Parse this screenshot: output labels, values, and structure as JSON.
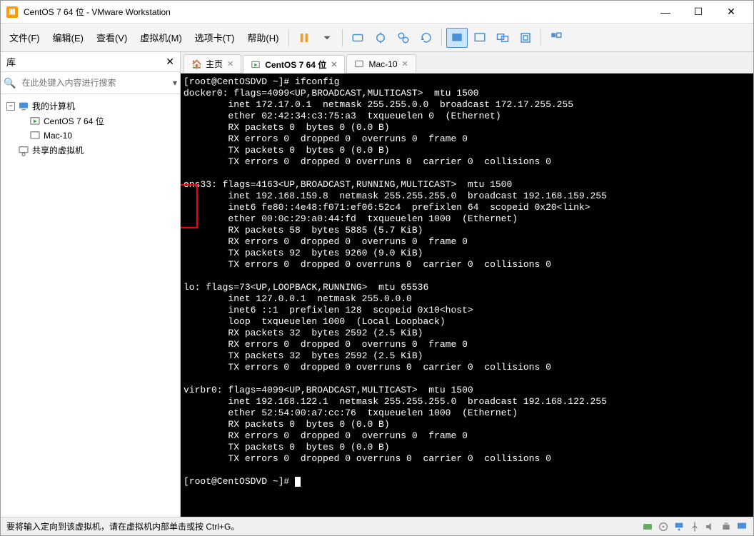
{
  "window": {
    "title": "CentOS 7 64 位 - VMware Workstation"
  },
  "menus": [
    "文件(F)",
    "编辑(E)",
    "查看(V)",
    "虚拟机(M)",
    "选项卡(T)",
    "帮助(H)"
  ],
  "sidebar": {
    "title": "库",
    "search_placeholder": "在此处键入内容进行搜索",
    "nodes": {
      "root": "我的计算机",
      "vm1": "CentOS 7 64 位",
      "vm2": "Mac-10",
      "shared": "共享的虚拟机"
    }
  },
  "tabs": {
    "home": "主页",
    "centos": "CentOS 7 64 位",
    "mac": "Mac-10"
  },
  "terminal_text": "[root@CentOSDVD ~]# ifconfig\ndocker0: flags=4099<UP,BROADCAST,MULTICAST>  mtu 1500\n        inet 172.17.0.1  netmask 255.255.0.0  broadcast 172.17.255.255\n        ether 02:42:34:c3:75:a3  txqueuelen 0  (Ethernet)\n        RX packets 0  bytes 0 (0.0 B)\n        RX errors 0  dropped 0  overruns 0  frame 0\n        TX packets 0  bytes 0 (0.0 B)\n        TX errors 0  dropped 0 overruns 0  carrier 0  collisions 0\n\nens33: flags=4163<UP,BROADCAST,RUNNING,MULTICAST>  mtu 1500\n        inet 192.168.159.8  netmask 255.255.255.0  broadcast 192.168.159.255\n        inet6 fe80::4e48:f071:ef06:52c4  prefixlen 64  scopeid 0x20<link>\n        ether 00:0c:29:a0:44:fd  txqueuelen 1000  (Ethernet)\n        RX packets 58  bytes 5885 (5.7 KiB)\n        RX errors 0  dropped 0  overruns 0  frame 0\n        TX packets 92  bytes 9260 (9.0 KiB)\n        TX errors 0  dropped 0 overruns 0  carrier 0  collisions 0\n\nlo: flags=73<UP,LOOPBACK,RUNNING>  mtu 65536\n        inet 127.0.0.1  netmask 255.0.0.0\n        inet6 ::1  prefixlen 128  scopeid 0x10<host>\n        loop  txqueuelen 1000  (Local Loopback)\n        RX packets 32  bytes 2592 (2.5 KiB)\n        RX errors 0  dropped 0  overruns 0  frame 0\n        TX packets 32  bytes 2592 (2.5 KiB)\n        TX errors 0  dropped 0 overruns 0  carrier 0  collisions 0\n\nvirbr0: flags=4099<UP,BROADCAST,MULTICAST>  mtu 1500\n        inet 192.168.122.1  netmask 255.255.255.0  broadcast 192.168.122.255\n        ether 52:54:00:a7:cc:76  txqueuelen 1000  (Ethernet)\n        RX packets 0  bytes 0 (0.0 B)\n        RX errors 0  dropped 0  overruns 0  frame 0\n        TX packets 0  bytes 0 (0.0 B)\n        TX errors 0  dropped 0 overruns 0  carrier 0  collisions 0\n\n[root@CentOSDVD ~]# ",
  "statusbar": {
    "message": "要将输入定向到该虚拟机，请在虚拟机内部单击或按 Ctrl+G。"
  }
}
